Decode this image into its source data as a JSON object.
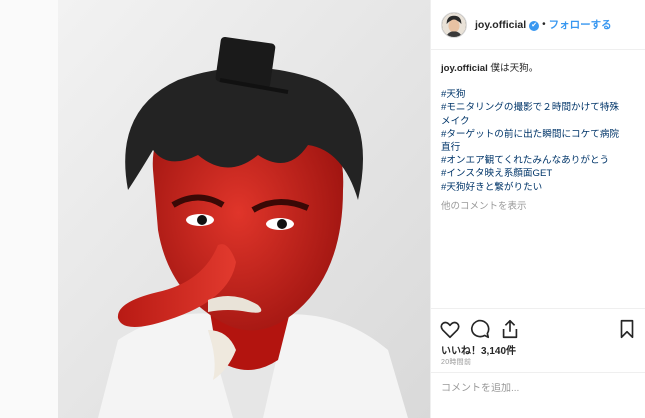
{
  "post": {
    "username": "joy.official",
    "verified_icon": "verified-badge-icon",
    "separator": "•",
    "follow_label": "フォローする",
    "caption_user": "joy.official",
    "caption_text": "僕は天狗。",
    "hashtags": [
      "#天狗",
      "#モニタリングの撮影で２時間かけて特殊",
      "メイク",
      "#ターゲットの前に出た瞬間にコケて病院",
      "直行",
      "#オンエア観てくれたみんなありがとう",
      "#インスタ映え系顔面GET",
      "#天狗好きと繋がりたい"
    ],
    "view_comments_label": "他のコメントを表示",
    "likes_text": "いいね！3,140件",
    "timestamp": "20時間前",
    "comment_placeholder": "コメントを追加...",
    "colors": {
      "link": "#3897f0",
      "hashtag": "#003569",
      "muted": "#999999",
      "skin_red": "#d8231e"
    },
    "icons": [
      "heart-icon",
      "comment-icon",
      "share-icon",
      "bookmark-icon"
    ]
  }
}
